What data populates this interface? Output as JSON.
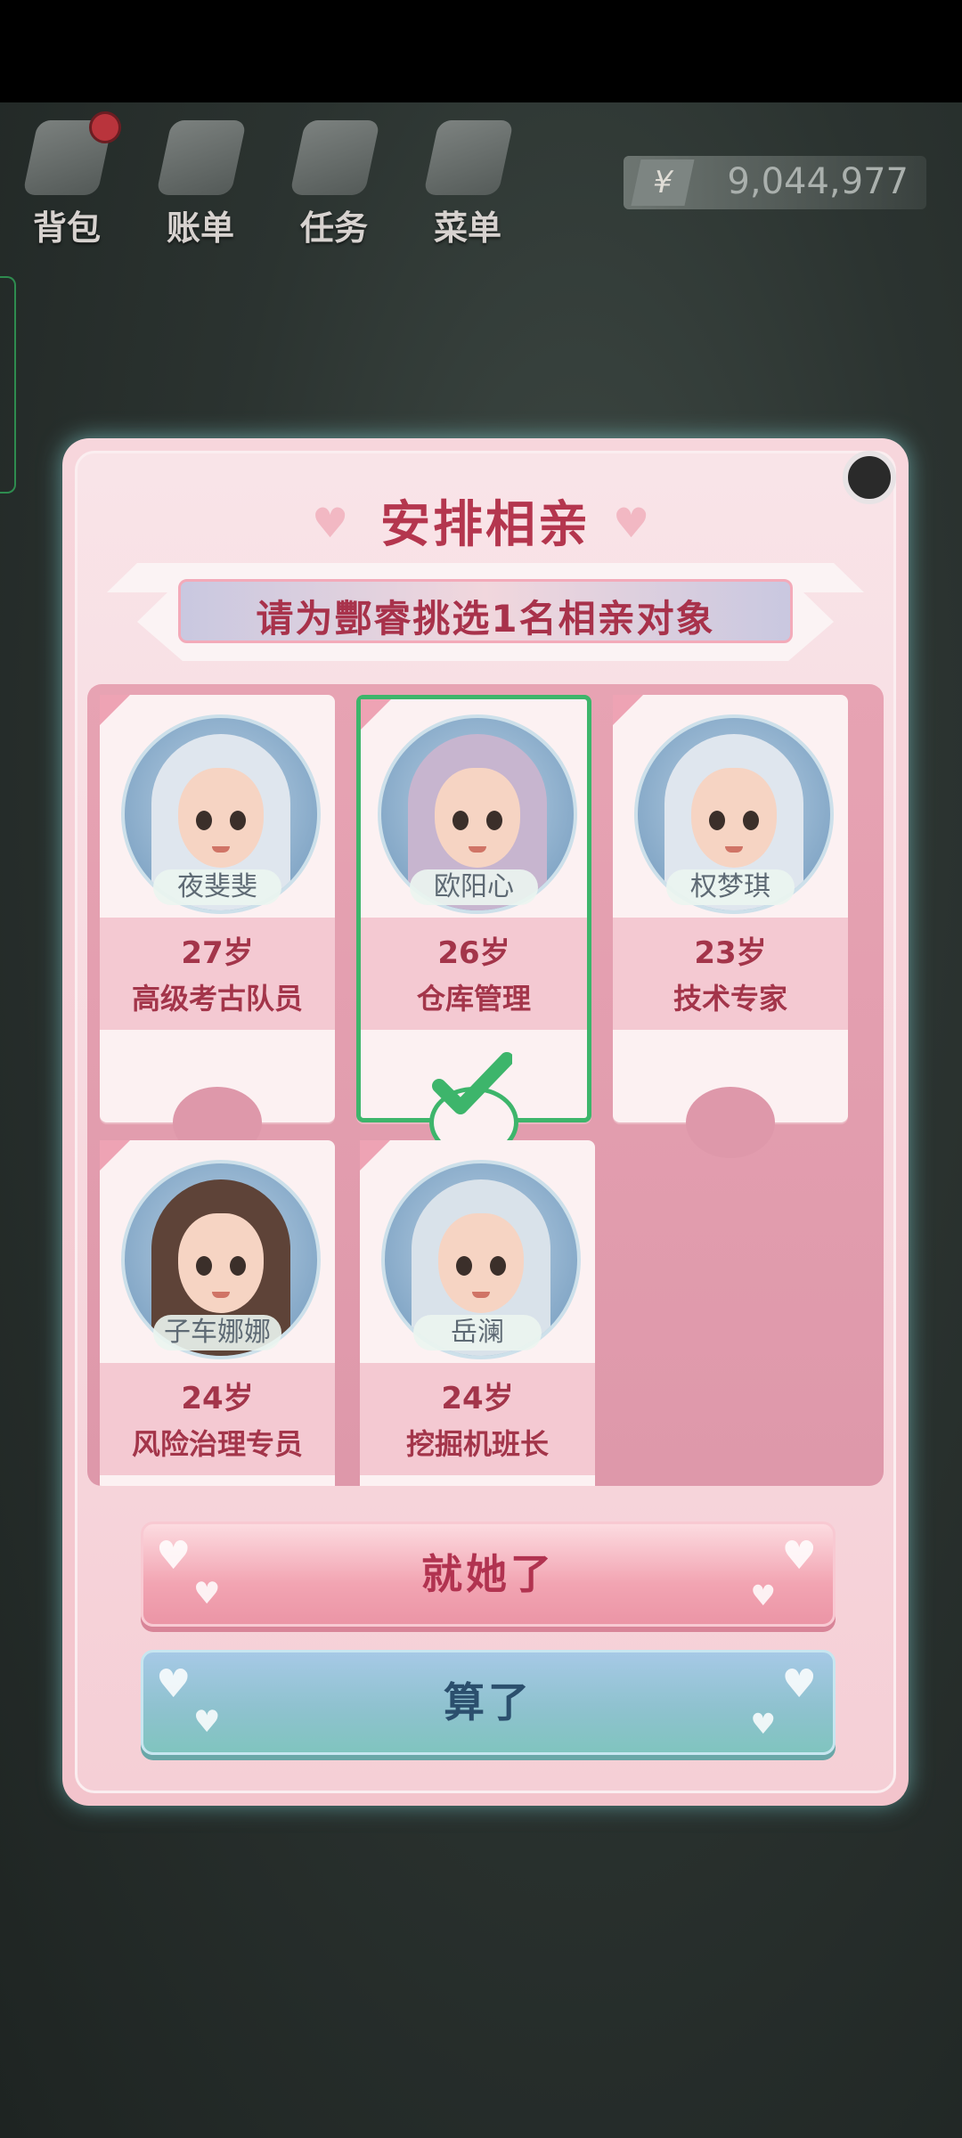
{
  "hud": {
    "items": [
      {
        "label": "背包",
        "icon": "backpack-icon",
        "has_badge": true
      },
      {
        "label": "账单",
        "icon": "bill-icon",
        "has_badge": false
      },
      {
        "label": "任务",
        "icon": "task-icon",
        "has_badge": false
      },
      {
        "label": "菜单",
        "icon": "menu-icon",
        "has_badge": false
      }
    ],
    "money": {
      "symbol": "¥",
      "value": "9,044,977"
    }
  },
  "dialog": {
    "title": "安排相亲",
    "subtitle": "请为酆睿挑选1名相亲对象",
    "candidates": [
      {
        "name": "夜斐斐",
        "age": "27岁",
        "job": "高级考古队员",
        "hair": "#dfe6ee",
        "selected": false
      },
      {
        "name": "欧阳心",
        "age": "26岁",
        "job": "仓库管理",
        "hair": "#c7b5cf",
        "selected": true
      },
      {
        "name": "权梦琪",
        "age": "23岁",
        "job": "技术专家",
        "hair": "#dfe6ee",
        "selected": false
      },
      {
        "name": "子车娜娜",
        "age": "24岁",
        "job": "风险治理专员",
        "hair": "#5e4338",
        "selected": false
      },
      {
        "name": "岳澜",
        "age": "24岁",
        "job": "挖掘机班长",
        "hair": "#d9e2ea",
        "selected": false
      }
    ],
    "confirm_label": "就她了",
    "cancel_label": "算了"
  },
  "colors": {
    "accent": "#b4364e",
    "selected": "#3db56b"
  }
}
